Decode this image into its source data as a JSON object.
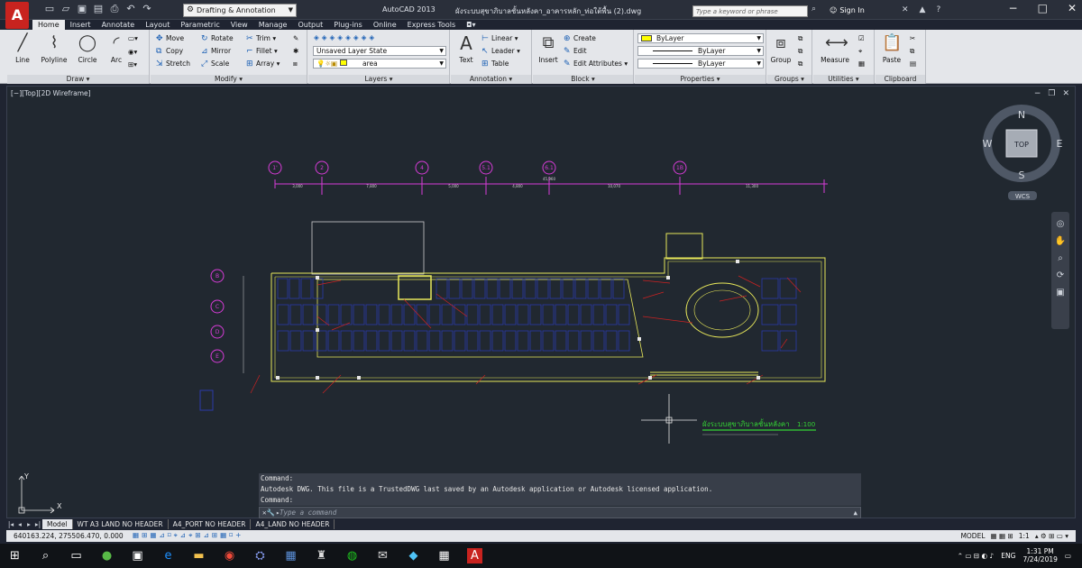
{
  "titlebar": {
    "workspace": "Drafting & Annotation",
    "app_name": "AutoCAD 2013",
    "document": "ผังระบบสุขาภิบาลชั้นหลังคา_อาคารหลัก_ท่อใต้พื้น (2).dwg",
    "search_placeholder": "Type a keyword or phrase",
    "sign_in": "Sign In"
  },
  "ribbon": {
    "tabs": [
      "Home",
      "Insert",
      "Annotate",
      "Layout",
      "Parametric",
      "View",
      "Manage",
      "Output",
      "Plug-ins",
      "Online",
      "Express Tools"
    ],
    "draw": {
      "title": "Draw",
      "line": "Line",
      "polyline": "Polyline",
      "circle": "Circle",
      "arc": "Arc"
    },
    "modify": {
      "title": "Modify",
      "move": "Move",
      "rotate": "Rotate",
      "trim": "Trim",
      "copy": "Copy",
      "mirror": "Mirror",
      "fillet": "Fillet",
      "stretch": "Stretch",
      "scale": "Scale",
      "array": "Array"
    },
    "layers": {
      "title": "Layers",
      "state": "Unsaved Layer State",
      "current": "area"
    },
    "annotation": {
      "title": "Annotation",
      "text": "Text",
      "linear": "Linear",
      "leader": "Leader",
      "table": "Table"
    },
    "block": {
      "title": "Block",
      "insert": "Insert",
      "create": "Create",
      "edit": "Edit",
      "edit_attributes": "Edit Attributes"
    },
    "properties": {
      "title": "Properties",
      "color": "ByLayer",
      "linetype": "ByLayer",
      "lineweight": "ByLayer"
    },
    "groups": {
      "title": "Groups",
      "group": "Group"
    },
    "utilities": {
      "title": "Utilities",
      "measure": "Measure"
    },
    "clipboard": {
      "title": "Clipboard",
      "paste": "Paste"
    }
  },
  "viewport": {
    "label": "[−][Top][2D Wireframe]",
    "viewcube": {
      "n": "N",
      "s": "S",
      "e": "E",
      "w": "W",
      "top": "TOP",
      "wcs": "WCS"
    },
    "axis_x": "X",
    "axis_y": "Y"
  },
  "drawing": {
    "grid_cols": [
      "1'",
      "2",
      "4",
      "5.1",
      "6.1",
      "1B"
    ],
    "grid_rows": [
      "B",
      "C",
      "D",
      "E"
    ],
    "dims": [
      "3,000",
      "7,800",
      "5,000",
      "4,800",
      "10,070",
      "11,300"
    ],
    "overall_dim": "45,960",
    "title": "ผังระบบสุขาภิบาลชั้นหลังคา",
    "scale": "1:100"
  },
  "command": {
    "line1": "Command:",
    "line2": "Autodesk DWG.  This file is a TrustedDWG last saved by an Autodesk application or Autodesk licensed application.",
    "line3": "Command:",
    "placeholder": "Type a command"
  },
  "layouts": [
    "Model",
    "WT A3 LAND NO HEADER",
    "A4_PORT NO HEADER",
    "A4_LAND NO HEADER"
  ],
  "status": {
    "coords": "640163.224, 275506.470, 0.000",
    "model": "MODEL",
    "scale": "1:1"
  },
  "taskbar": {
    "lang": "ENG",
    "time": "1:31 PM",
    "date": "7/24/2019"
  },
  "colors": {
    "accent_red": "#c8231f",
    "cad_bg": "#212830",
    "outline_yellow": "#e8e85a",
    "slab_blue": "#2b3aa8",
    "grid_magenta": "#d83cd8",
    "label_green": "#34d334"
  }
}
